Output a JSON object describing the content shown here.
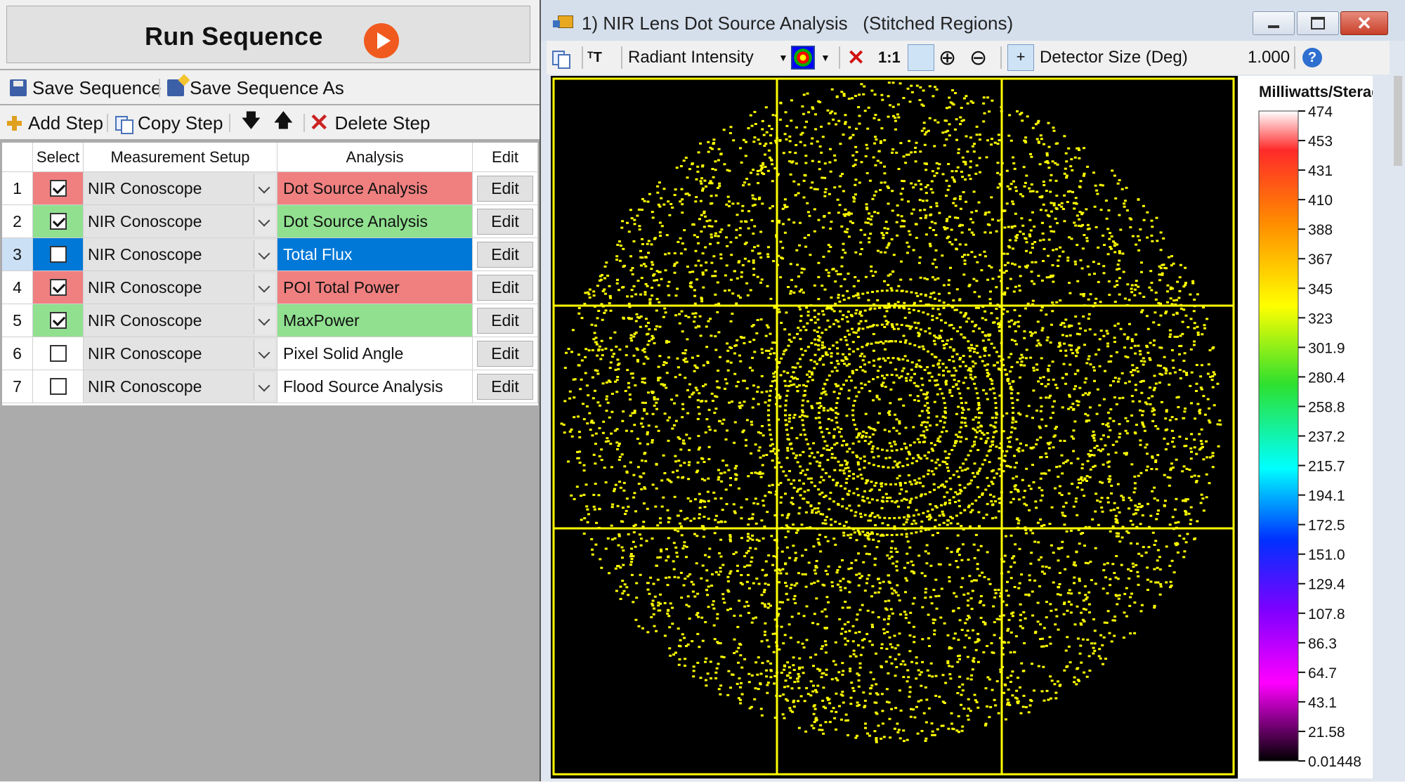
{
  "run": {
    "label": "Run Sequence"
  },
  "save_toolbar": {
    "save": "Save Sequence",
    "save_as": "Save Sequence As"
  },
  "step_toolbar": {
    "add": "Add Step",
    "copy": "Copy Step",
    "move_down": "🡇",
    "move_up": "🡅",
    "delete": "Delete Step"
  },
  "grid": {
    "headers": {
      "select": "Select",
      "setup": "Measurement Setup",
      "analysis": "Analysis",
      "edit": "Edit"
    },
    "rows": [
      {
        "num": "1",
        "checked": true,
        "setup": "NIR Conoscope",
        "analysis": "Dot Source Analysis",
        "status": "red",
        "edit": "Edit"
      },
      {
        "num": "2",
        "checked": true,
        "setup": "NIR Conoscope",
        "analysis": "Dot Source Analysis",
        "status": "green",
        "edit": "Edit"
      },
      {
        "num": "3",
        "checked": false,
        "setup": "NIR Conoscope",
        "analysis": "Total Flux",
        "status": "selected",
        "edit": "Edit"
      },
      {
        "num": "4",
        "checked": true,
        "setup": "NIR Conoscope",
        "analysis": "POI Total Power",
        "status": "red",
        "edit": "Edit"
      },
      {
        "num": "5",
        "checked": true,
        "setup": "NIR Conoscope",
        "analysis": "MaxPower",
        "status": "green",
        "edit": "Edit"
      },
      {
        "num": "6",
        "checked": false,
        "setup": "NIR Conoscope",
        "analysis": "Pixel Solid Angle",
        "status": "none",
        "edit": "Edit"
      },
      {
        "num": "7",
        "checked": false,
        "setup": "NIR Conoscope",
        "analysis": "Flood Source Analysis",
        "status": "none",
        "edit": "Edit"
      }
    ],
    "status_colors": {
      "red": "#f08080",
      "green": "#90e090",
      "selected": "#0078d7"
    }
  },
  "window": {
    "title": "1) NIR Lens Dot Source Analysis   (Stitched Regions)",
    "close_glyph": "✕"
  },
  "image_toolbar": {
    "display_mode": "Radiant Intensity",
    "one_to_one": "1:1",
    "detector_size_label": "Detector Size (Deg)",
    "detector_size_value": "1.000",
    "help": "?"
  },
  "plot": {
    "overlay_color": "#ffff00",
    "colorbar_title": "Milliwatts/Steradian",
    "colorbar_ticks": [
      "474",
      "453",
      "431",
      "410",
      "388",
      "367",
      "345",
      "323",
      "301.9",
      "280.4",
      "258.8",
      "237.2",
      "215.7",
      "194.1",
      "172.5",
      "151.0",
      "129.4",
      "107.8",
      "86.3",
      "64.7",
      "43.1",
      "21.58",
      "0.01448"
    ]
  }
}
